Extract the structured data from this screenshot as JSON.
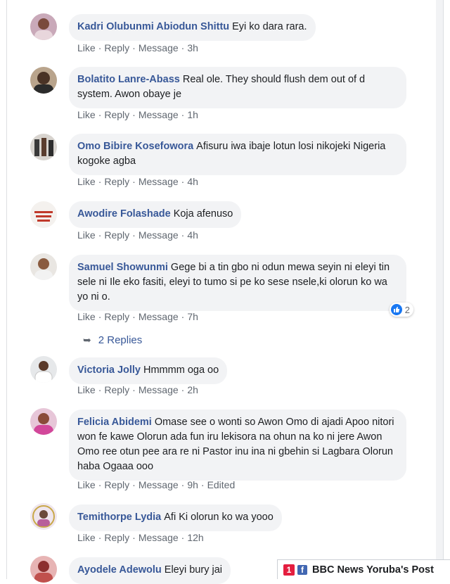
{
  "actions": {
    "like": "Like",
    "reply": "Reply",
    "message": "Message",
    "dot": "·"
  },
  "comments": [
    {
      "author": "Kadri Olubunmi Abiodun Shittu",
      "text": "Eyi ko dara rara.",
      "time": "3h"
    },
    {
      "author": "Bolatito Lanre-Abass",
      "text": "Real ole. They should flush dem out of d system. Awon obaye je",
      "time": "1h"
    },
    {
      "author": "Omo Bibire Kosefowora",
      "text": "Afisuru iwa ibaje lotun losi nikojeki Nigeria kogoke agba",
      "time": "4h"
    },
    {
      "author": "Awodire Folashade",
      "text": "Koja afenuso",
      "time": "4h"
    },
    {
      "author": "Samuel Showunmi",
      "text": "Gege bi a tin gbo ni odun mewa seyin ni eleyi tin sele ni Ile eko fasiti, eleyi to tumo si pe ko sese nsele,ki olorun ko wa yo ni o.",
      "time": "7h",
      "reaction_count": "2",
      "replies": "2 Replies"
    },
    {
      "author": "Victoria Jolly",
      "text": "Hmmmm oga oo",
      "time": "2h"
    },
    {
      "author": "Felicia Abidemi",
      "text": "Omase see o wonti so Awon Omo di ajadi Apoo nitori won fe kawe Olorun ada fun iru lekisora na ohun na ko ni jere Awon Omo ree otun pee ara re ni Pastor inu ina ni gbehin si Lagbara Olorun haba Ogaaa ooo",
      "time": "9h",
      "edited": "Edited"
    },
    {
      "author": "Temithorpe Lydia",
      "text": "Afi Ki olorun ko wa yooo",
      "time": "12h"
    },
    {
      "author": "Ayodele Adewolu",
      "text": "Eleyi bury jai"
    }
  ],
  "notification": {
    "count": "1",
    "label": "BBC News Yoruba's Post",
    "icon": "facebook-icon"
  },
  "colors": {
    "author": "#385898",
    "bubble": "#f2f3f5",
    "meta": "#606770",
    "like": "#1877f2",
    "badge": "#e41e3f"
  }
}
